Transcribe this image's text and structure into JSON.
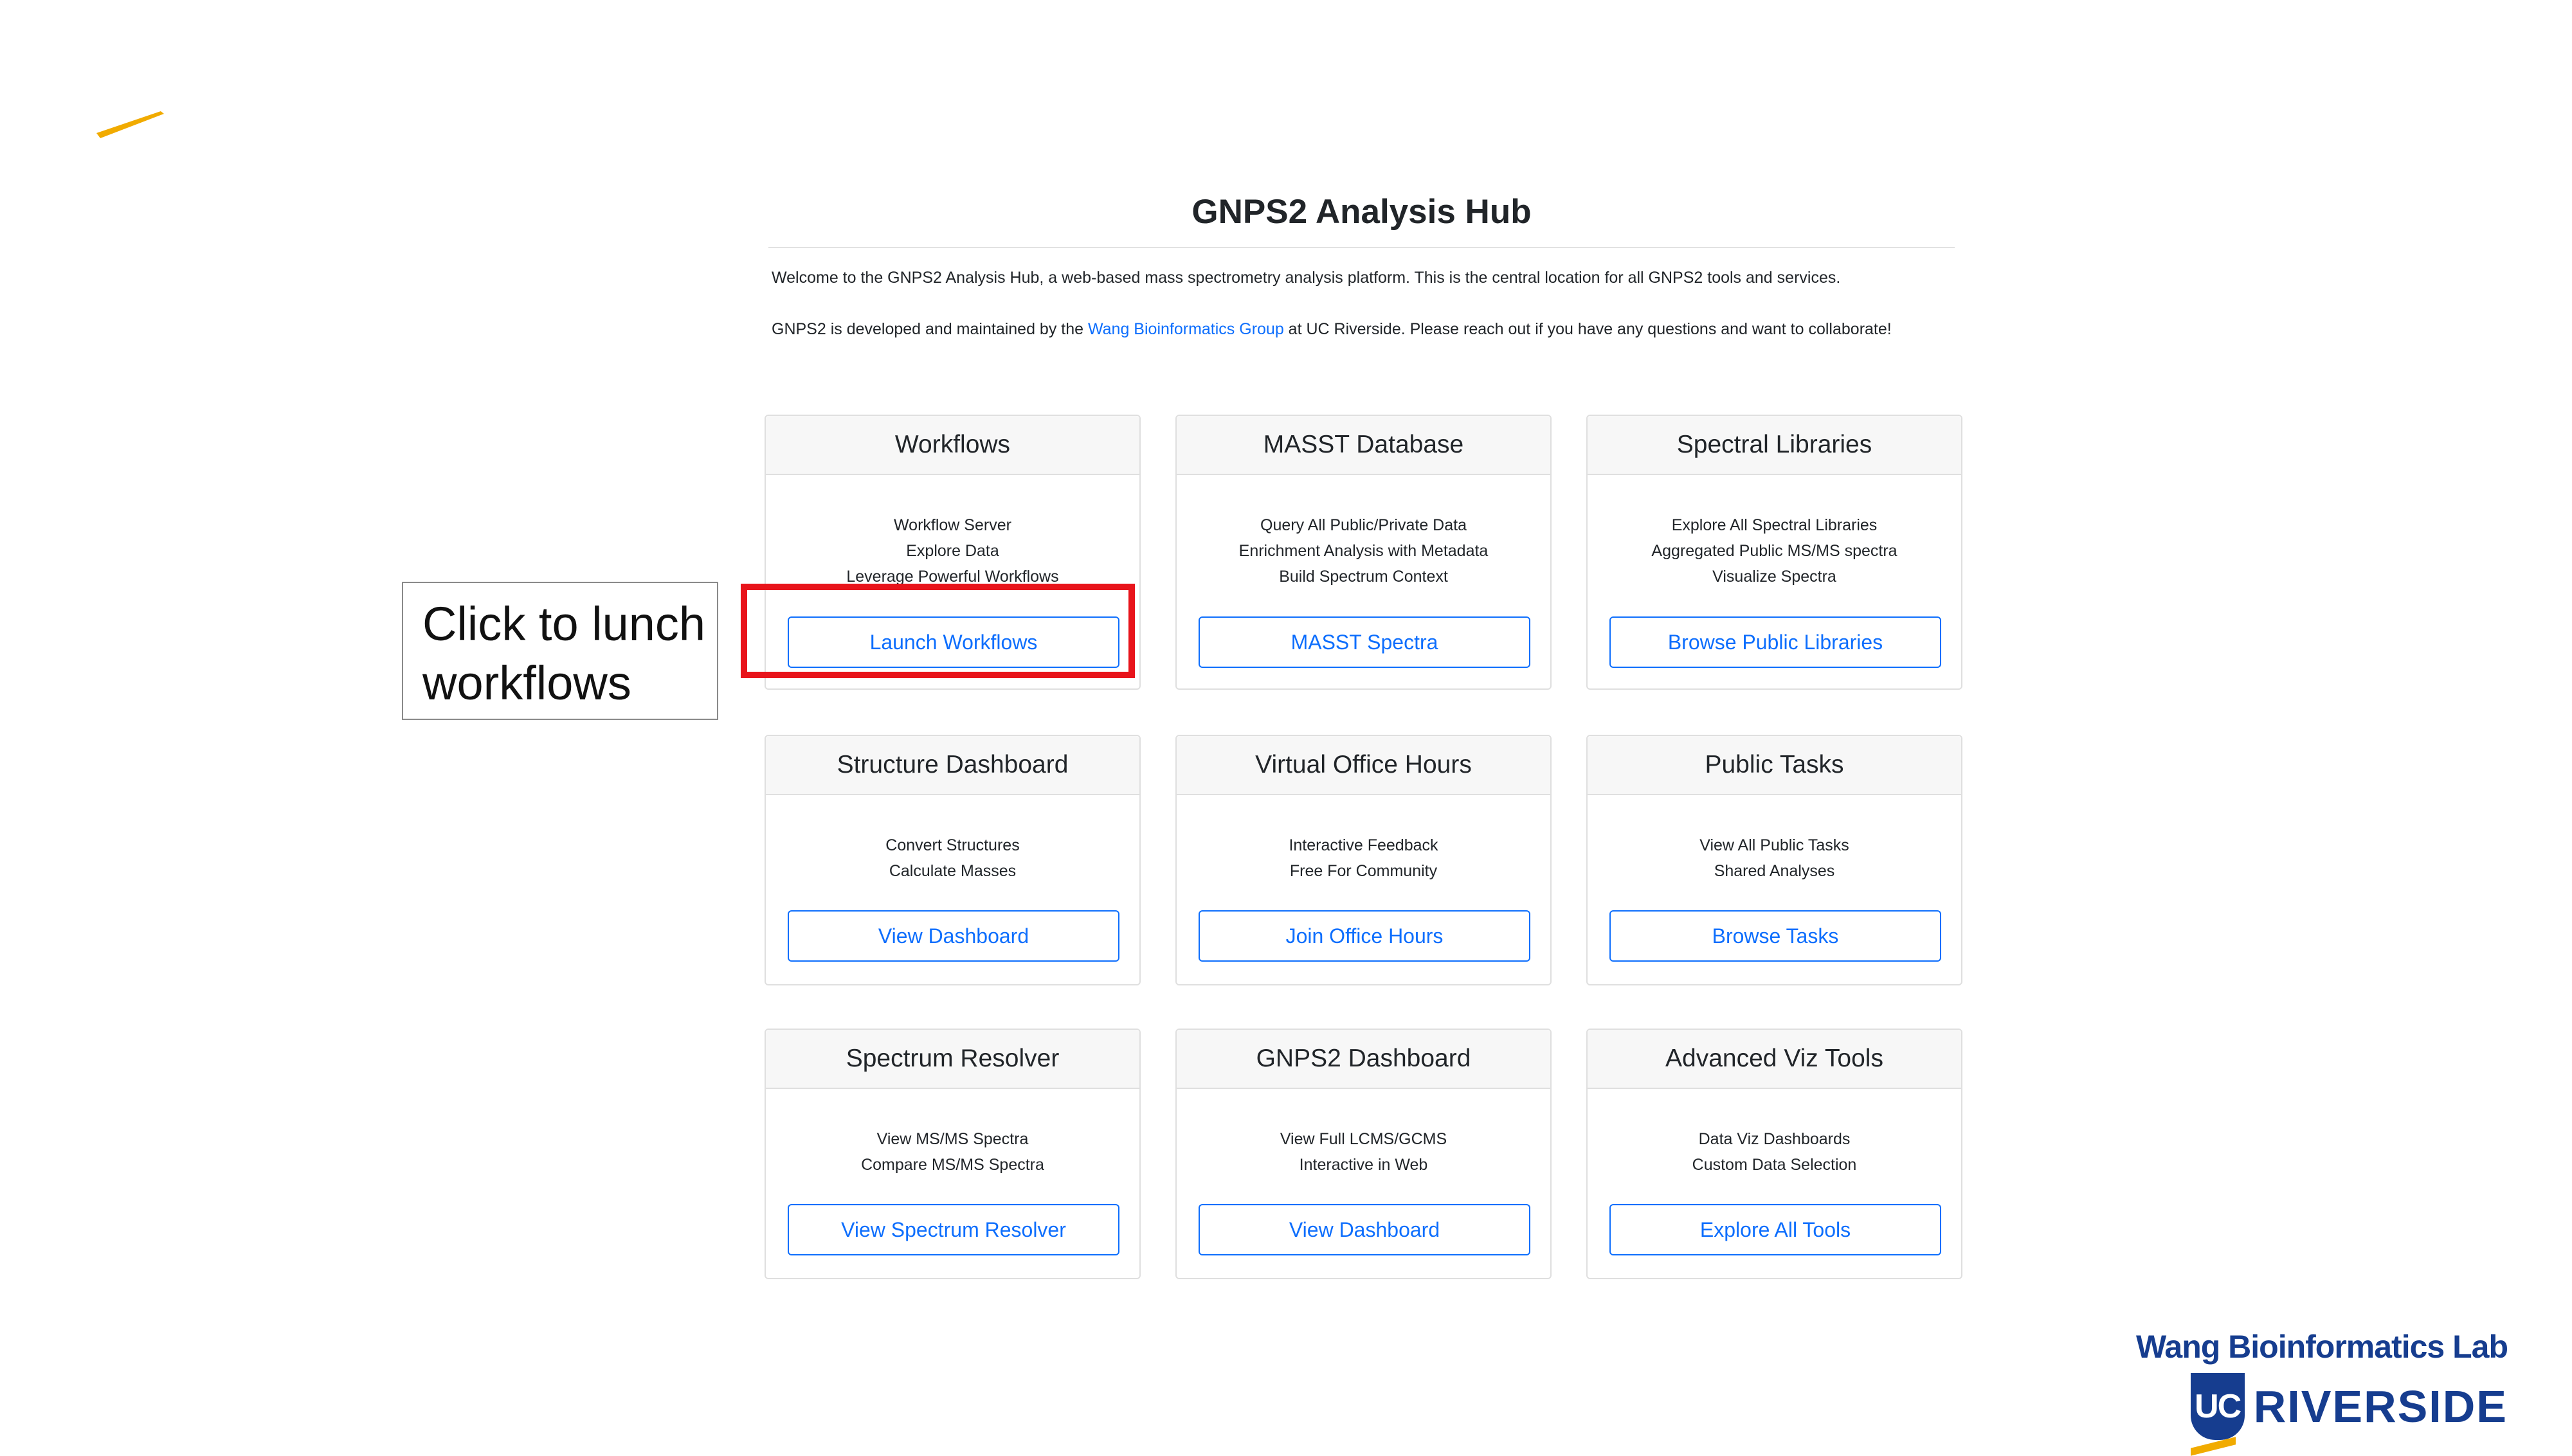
{
  "hub": {
    "title": "GNPS2 Analysis Hub",
    "intro": "Welcome to the GNPS2 Analysis Hub, a web-based mass spectrometry analysis platform. This is the central location for all GNPS2 tools and services.",
    "about_prefix": "GNPS2 is developed and maintained by the ",
    "about_link": "Wang Bioinformatics Group",
    "about_suffix": " at UC Riverside. Please reach out if you have any questions and want to collaborate!"
  },
  "cards": [
    {
      "title": "Workflows",
      "lines": [
        "Workflow Server",
        "Explore Data",
        "Leverage Powerful Workflows"
      ],
      "button": "Launch Workflows"
    },
    {
      "title": "MASST Database",
      "lines": [
        "Query All Public/Private Data",
        "Enrichment Analysis with Metadata",
        "Build Spectrum Context"
      ],
      "button": "MASST Spectra"
    },
    {
      "title": "Spectral Libraries",
      "lines": [
        "Explore All Spectral Libraries",
        "Aggregated Public MS/MS spectra",
        "Visualize Spectra"
      ],
      "button": "Browse Public Libraries"
    },
    {
      "title": "Structure Dashboard",
      "lines": [
        "Convert Structures",
        "Calculate Masses"
      ],
      "button": "View Dashboard"
    },
    {
      "title": "Virtual Office Hours",
      "lines": [
        "Interactive Feedback",
        "Free For Community"
      ],
      "button": "Join Office Hours"
    },
    {
      "title": "Public Tasks",
      "lines": [
        "View All Public Tasks",
        "Shared Analyses"
      ],
      "button": "Browse Tasks"
    },
    {
      "title": "Spectrum Resolver",
      "lines": [
        "View MS/MS Spectra",
        "Compare MS/MS Spectra"
      ],
      "button": "View Spectrum Resolver"
    },
    {
      "title": "GNPS2 Dashboard",
      "lines": [
        "View Full LCMS/GCMS",
        "Interactive in Web"
      ],
      "button": "View Dashboard"
    },
    {
      "title": "Advanced Viz Tools",
      "lines": [
        "Data Viz Dashboards",
        "Custom Data Selection"
      ],
      "button": "Explore All Tools"
    }
  ],
  "annotation": {
    "callout_text": "Click to lunch\nworkflows",
    "highlight_color": "#e8141b"
  },
  "branding": {
    "lab_name": "Wang Bioinformatics Lab",
    "uc_mark": "UC",
    "university": "RIVERSIDE",
    "brand_color": "#163d8f",
    "accent_color": "#f1ab00"
  },
  "theme": {
    "link_color": "#0d6efd",
    "card_header_bg": "#f7f7f7"
  }
}
